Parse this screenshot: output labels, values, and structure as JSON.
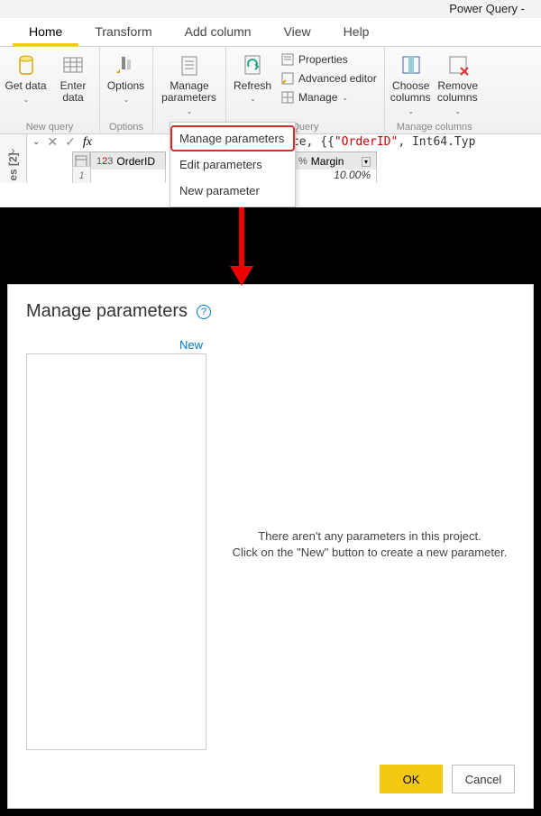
{
  "title": "Power Query -",
  "tabs": [
    "Home",
    "Transform",
    "Add column",
    "View",
    "Help"
  ],
  "ribbon": {
    "newquery": {
      "label": "New query",
      "getdata": "Get data",
      "enterdata": "Enter data"
    },
    "options": {
      "label": "Options",
      "options": "Options"
    },
    "parameters": {
      "button": "Manage parameters"
    },
    "query": {
      "label": "Query",
      "refresh": "Refresh",
      "properties": "Properties",
      "advanced": "Advanced editor",
      "manage": "Manage"
    },
    "managecols": {
      "label": "Manage columns",
      "choose": "Choose columns",
      "remove": "Remove columns"
    }
  },
  "dropdown": {
    "manage": "Manage parameters",
    "edit": "Edit parameters",
    "new": "New parameter"
  },
  "sidebar": "es [2]",
  "formula": {
    "prefix": "mnTypes(Source, {{",
    "q1": "\"OrderID\"",
    "suffix": ", Int64.Typ"
  },
  "grid": {
    "col1": {
      "type123": "123",
      "name": "OrderID"
    },
    "col2": {
      "pct": "%",
      "name": "Margin"
    },
    "row1": "1",
    "val2": "10.00%"
  },
  "dialog": {
    "title": "Manage parameters",
    "new": "New",
    "empty1": "There aren't any parameters in this project.",
    "empty2": "Click on the \"New\" button to create a new parameter.",
    "ok": "OK",
    "cancel": "Cancel"
  }
}
